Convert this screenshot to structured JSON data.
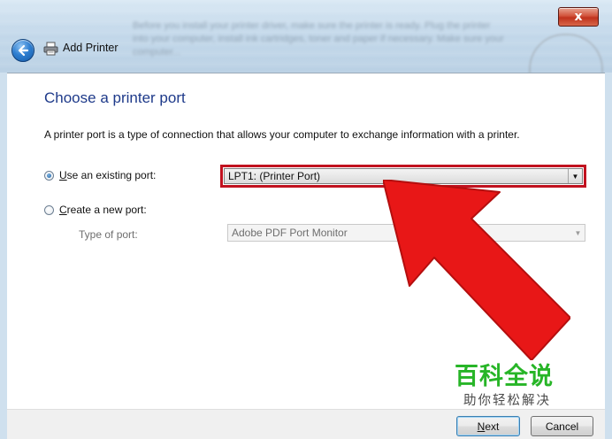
{
  "window": {
    "title": "Add Printer",
    "background_text": "Before you install your printer driver, make sure the printer is ready. Plug the printer into your computer, install ink cartridges, toner and paper if necessary. Make sure your computer..."
  },
  "page": {
    "heading": "Choose a printer port",
    "description": "A printer port is a type of connection that allows your computer to exchange information with a printer."
  },
  "options": {
    "existing_port": {
      "label_underlined": "U",
      "label_rest": "se an existing port:",
      "checked": true,
      "selected_value": "LPT1: (Printer Port)"
    },
    "new_port": {
      "label_underlined": "C",
      "label_rest": "reate a new port:",
      "checked": false
    },
    "type_of_port": {
      "label": "Type of port:",
      "selected_value": "Adobe PDF Port Monitor"
    }
  },
  "buttons": {
    "next_underlined": "N",
    "next_rest": "ext",
    "cancel": "Cancel",
    "close_glyph": "x"
  },
  "watermark": {
    "title": "百科全说",
    "subtitle": "助你轻松解决"
  },
  "colors": {
    "heading": "#1e3a8a",
    "highlight_border": "#c1121f",
    "arrow": "#e81717",
    "watermark_green": "#27b527"
  },
  "icons": [
    "back-arrow-icon",
    "printer-icon",
    "close-icon",
    "dropdown-arrow-icon"
  ]
}
